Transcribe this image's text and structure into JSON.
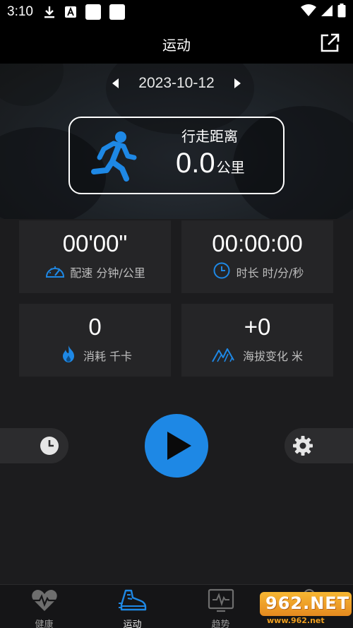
{
  "status_bar": {
    "time": "3:10"
  },
  "header": {
    "title": "运动"
  },
  "date_nav": {
    "date": "2023-10-12"
  },
  "distance": {
    "label": "行走距离",
    "value": "0.0",
    "unit": "公里"
  },
  "stats": [
    {
      "value": "00'00\"",
      "label": "配速 分钟/公里",
      "icon": "speedometer-icon"
    },
    {
      "value": "00:00:00",
      "label": "时长 时/分/秒",
      "icon": "clock-icon"
    },
    {
      "value": "0",
      "label": "消耗 千卡",
      "icon": "flame-icon"
    },
    {
      "value": "+0",
      "label": "海拔变化 米",
      "icon": "mountain-icon"
    }
  ],
  "colors": {
    "accent": "#1e88e5",
    "background": "#1c1c1e",
    "tile": "#252527"
  },
  "bottom_nav": {
    "items": [
      {
        "label": "健康",
        "icon": "heart-pulse-icon"
      },
      {
        "label": "运动",
        "icon": "shoe-icon",
        "active": true
      },
      {
        "label": "趋势",
        "icon": "trend-monitor-icon"
      },
      {
        "label": "",
        "icon": "profile-icon"
      }
    ]
  },
  "watermark": {
    "logo": "962.NET",
    "url": "www.962.net"
  }
}
